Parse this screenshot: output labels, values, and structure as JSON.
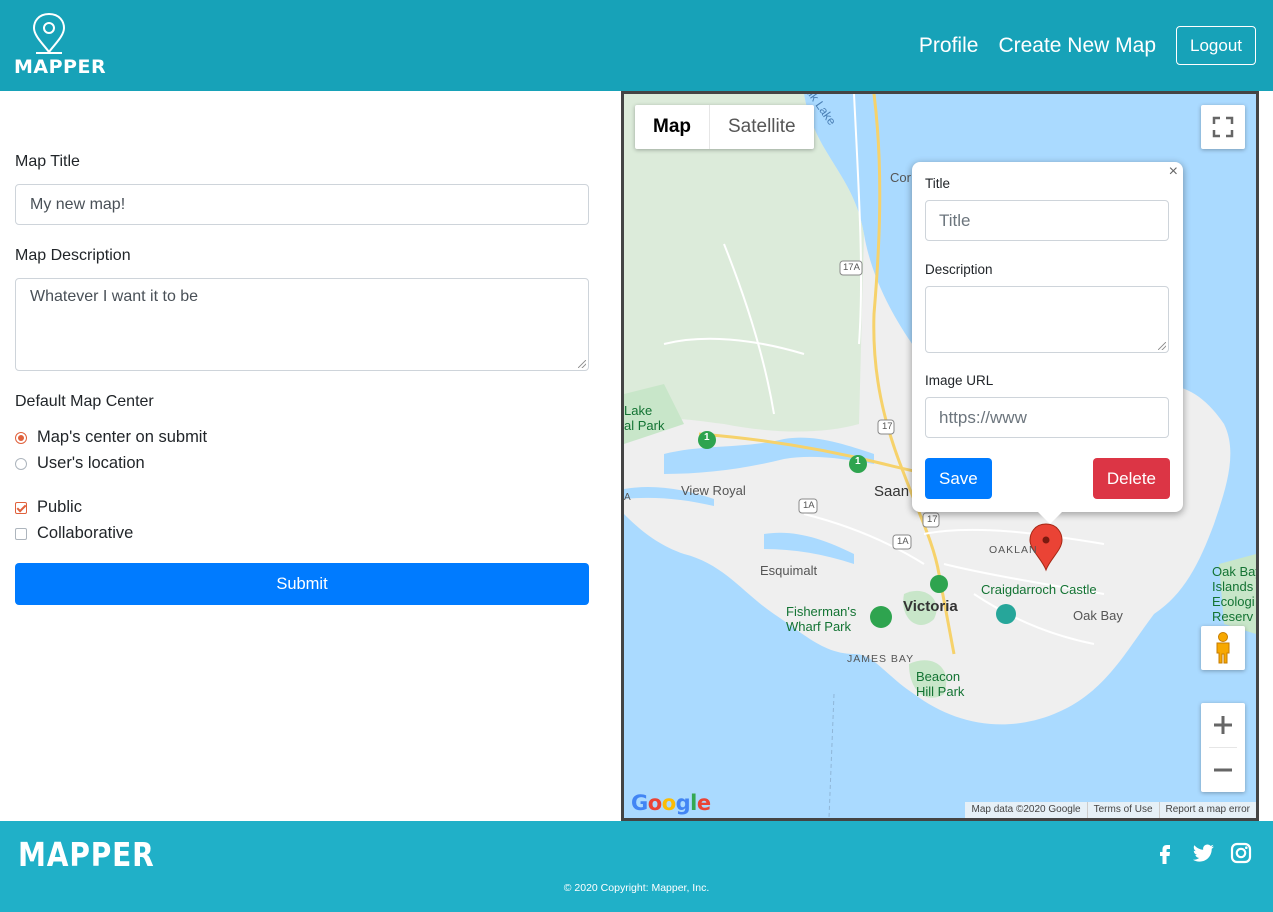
{
  "header": {
    "logo_text": "MAPPER",
    "nav": {
      "profile": "Profile",
      "create": "Create New Map",
      "logout": "Logout"
    }
  },
  "form": {
    "title_label": "Map Title",
    "title_value": "My new map!",
    "desc_label": "Map Description",
    "desc_value": "Whatever I want it to be",
    "center_label": "Default Map Center",
    "center_options": [
      "Map's center on submit",
      "User's location"
    ],
    "center_selected": "Map's center on submit",
    "public_label": "Public",
    "public_checked": true,
    "collab_label": "Collaborative",
    "collab_checked": false,
    "submit_label": "Submit"
  },
  "map": {
    "type_buttons": [
      "Map",
      "Satellite"
    ],
    "active_type": "Map",
    "labels": {
      "elk_lake": "Elk Lake",
      "cor": "Cor",
      "lake_park": "Lake\nal Park",
      "view_royal": "View Royal",
      "saanich": "Saan",
      "esquimalt": "Esquimalt",
      "victoria": "Victoria",
      "fishermans": "Fisherman's\nWharf Park",
      "james_bay": "JAMES BAY",
      "beacon_hill": "Beacon\nHill Park",
      "craigdarroch": "Craigdarroch Castle",
      "oak_bay": "Oak Bay",
      "oakland": "OAKLAN",
      "oak_bay_islands": "Oak Bay\nIslands\nEcologi\nReserv",
      "a": "A",
      "r17a": "17A",
      "r17": "17",
      "r1a": "1A",
      "r1": "1"
    },
    "attribution": [
      "Map data ©2020 Google",
      "Terms of Use",
      "Report a map error"
    ],
    "google": "Google",
    "popup": {
      "title_label": "Title",
      "title_placeholder": "Title",
      "desc_label": "Description",
      "image_label": "Image URL",
      "image_placeholder": "https://www",
      "save": "Save",
      "delete": "Delete",
      "close": "×"
    },
    "marker_color": "#ea4335"
  },
  "footer": {
    "logo_text": "MAPPER",
    "copyright": "© 2020 Copyright: Mapper, Inc.",
    "social": [
      "facebook-icon",
      "twitter-icon",
      "instagram-icon"
    ]
  }
}
